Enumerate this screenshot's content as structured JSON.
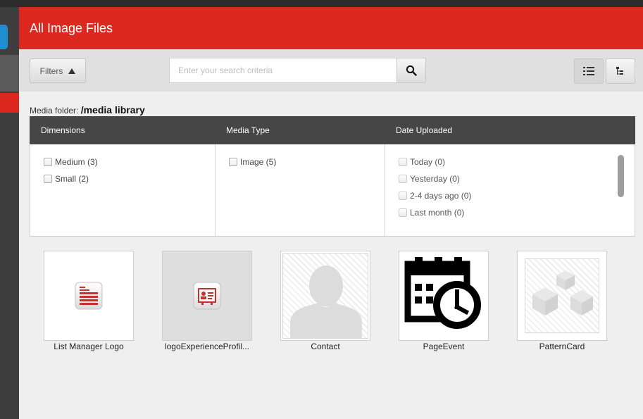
{
  "header": {
    "title": "All Image Files"
  },
  "toolbar": {
    "filters_label": "Filters",
    "search_placeholder": "Enter your search criteria",
    "search_value": ""
  },
  "media_folder": {
    "label": "Media folder:",
    "path": "/media library"
  },
  "facets": [
    {
      "title": "Dimensions",
      "items": [
        {
          "label": "Medium (3)"
        },
        {
          "label": "Small (2)"
        }
      ]
    },
    {
      "title": "Media Type",
      "items": [
        {
          "label": "Image (5)"
        }
      ]
    },
    {
      "title": "Date Uploaded",
      "items": [
        {
          "label": "Today (0)"
        },
        {
          "label": "Yesterday (0)"
        },
        {
          "label": "2-4 days ago (0)"
        },
        {
          "label": "Last month (0)"
        }
      ]
    }
  ],
  "thumbnails": [
    {
      "label": "List Manager Logo",
      "icon": "list-manager-icon"
    },
    {
      "label": "logoExperienceProfil...",
      "icon": "experience-profile-icon"
    },
    {
      "label": "Contact",
      "icon": "contact-silhouette-icon"
    },
    {
      "label": "PageEvent",
      "icon": "calendar-clock-icon"
    },
    {
      "label": "PatternCard",
      "icon": "cubes-placeholder-icon"
    }
  ],
  "colors": {
    "accent": "#dd2820",
    "header_bar": "#464646",
    "rail": "#3e3e3e",
    "rail_button": "#1e8fd0"
  }
}
